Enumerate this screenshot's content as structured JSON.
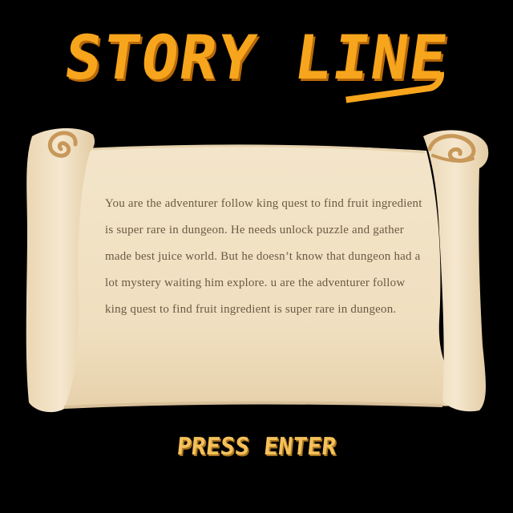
{
  "screen": {
    "title": "STORY LINE",
    "story": "You are the adventurer follow king quest to find fruit ingredient is super rare in dungeon. He needs unlock puzzle and gather made best juice world. But he doesn’t know that dungeon had a lot mystery waiting him explore. u are the adventurer follow king quest to find fruit ingredient is super rare in dungeon.",
    "prompt": "PRESS ENTER"
  },
  "colors": {
    "background": "#000000",
    "title": "#f7a51c",
    "scroll_paper": "#f2e2c4",
    "scroll_edge": "#dcc6a0",
    "story_text": "#6b5a44",
    "prompt": "#f4c15a"
  },
  "icons": {
    "left_curl": "scroll-curl-icon",
    "right_curl": "scroll-curl-icon"
  }
}
